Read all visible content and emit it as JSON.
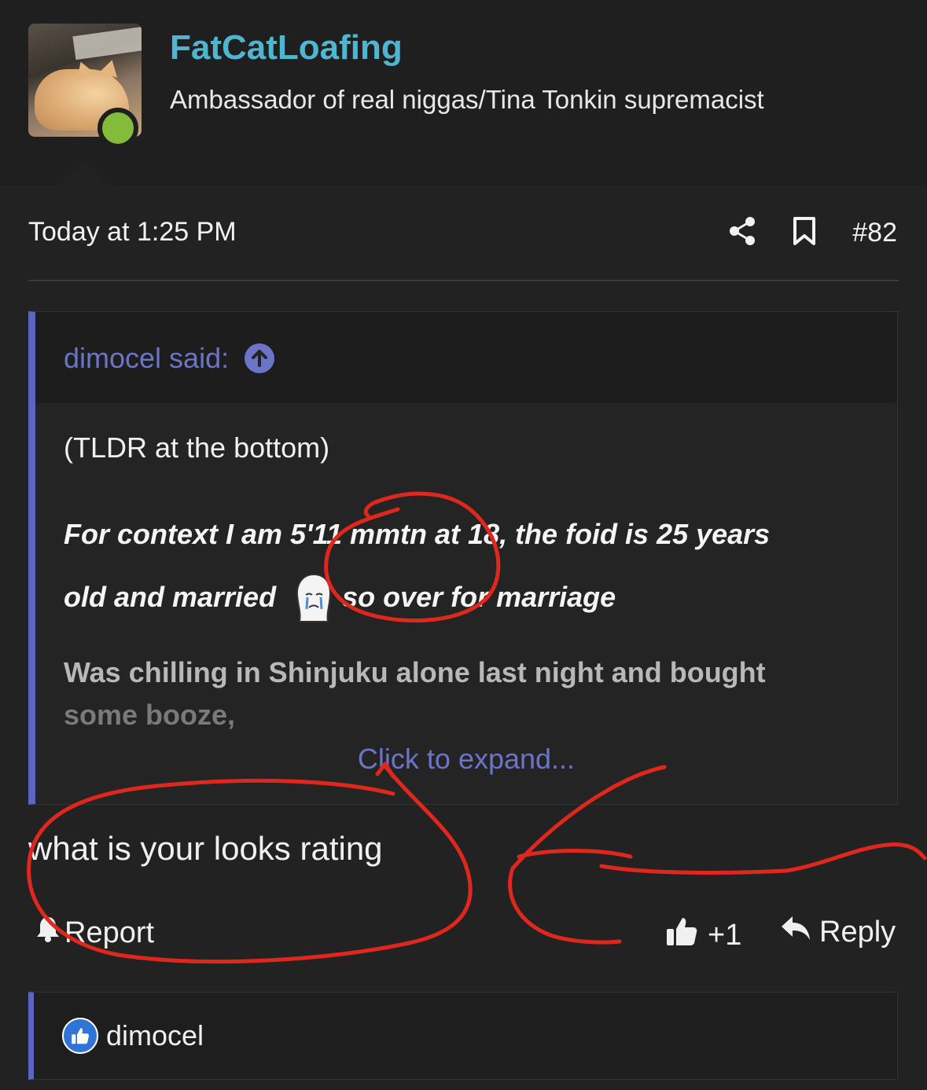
{
  "user": {
    "name": "FatCatLoafing",
    "title": "Ambassador of real niggas/Tina Tonkin supremacist"
  },
  "post": {
    "timestamp": "Today at 1:25 PM",
    "number": "#82",
    "icons": [
      "share-icon",
      "bookmark-icon"
    ]
  },
  "quote": {
    "author": "dimocel said:",
    "line1": "(TLDR at the bottom)",
    "bold1": "For context I am 5'11 mmtn at 18, the foid is 25 years",
    "bold2a": "old and married",
    "bold2b": "so over for marriage",
    "fade1": "Was chilling in Shinjuku alone last night and bought",
    "fade2": "some booze,",
    "expand": "Click to expand..."
  },
  "reply_text": "what is your looks rating",
  "actions": {
    "report": "Report",
    "like_count": "+1",
    "reply": "Reply"
  },
  "reactions": {
    "user": "dimocel"
  },
  "colors": {
    "background": "#222223",
    "username": "#4fb6d1",
    "accent": "#6c74c8",
    "online": "#84bb3b",
    "annotation": "#e0271d"
  }
}
